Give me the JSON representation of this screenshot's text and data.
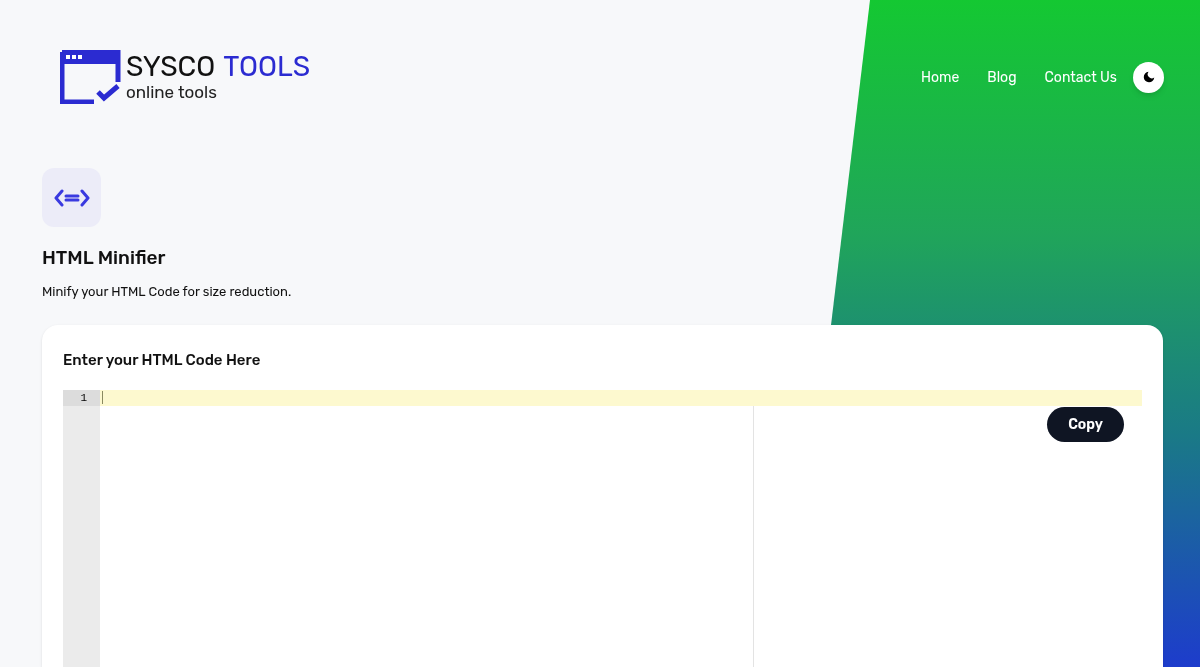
{
  "logo": {
    "name": "SYSCO",
    "accent": "TOOLS",
    "tagline": "online tools"
  },
  "nav": {
    "links": [
      {
        "label": "Home"
      },
      {
        "label": "Blog"
      },
      {
        "label": "Contact Us"
      }
    ]
  },
  "tool": {
    "title": "HTML Minifier",
    "description": "Minify your HTML Code for size reduction."
  },
  "editor": {
    "heading": "Enter your HTML Code Here",
    "line_numbers": [
      "1"
    ],
    "copy_button": "Copy"
  }
}
